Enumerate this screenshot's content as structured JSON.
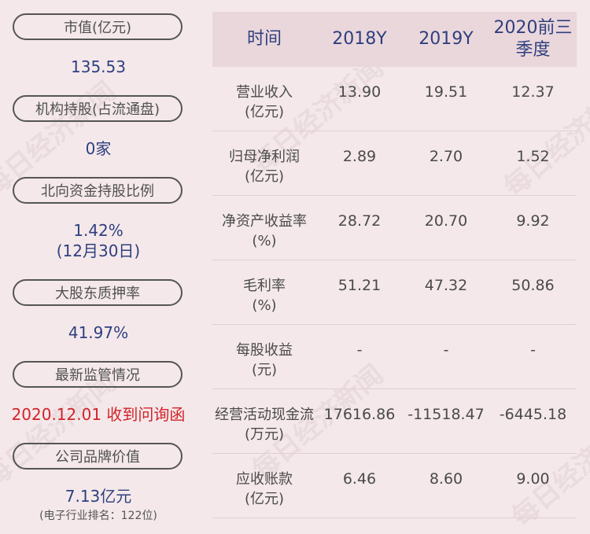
{
  "left": {
    "items": [
      {
        "label": "市值(亿元)",
        "value": "135.53"
      },
      {
        "label": "机构持股(占流通盘)",
        "value": "0家"
      },
      {
        "label": "北向资金持股比例",
        "value": "1.42%",
        "value2": "(12月30日)"
      },
      {
        "label": "大股东质押率",
        "value": "41.97%"
      },
      {
        "label": "最新监管情况",
        "value": "2020.12.01 收到问询函",
        "value_color": "#d2232a"
      },
      {
        "label": "公司品牌价值",
        "value": "7.13亿元",
        "value2": "(电子行业排名：122位)"
      }
    ]
  },
  "table": {
    "headers": [
      "时间",
      "2018Y",
      "2019Y",
      "2020前三季度"
    ],
    "header_line1": "2020前三",
    "header_line2": "季度",
    "rows": [
      {
        "label1": "营业收入",
        "label2": "(亿元)",
        "values": [
          "13.90",
          "19.51",
          "12.37"
        ]
      },
      {
        "label1": "归母净利润",
        "label2": "(亿元)",
        "values": [
          "2.89",
          "2.70",
          "1.52"
        ]
      },
      {
        "label1": "净资产收益率",
        "label2": "(%)",
        "values": [
          "28.72",
          "20.70",
          "9.92"
        ]
      },
      {
        "label1": "毛利率",
        "label2": "(%)",
        "values": [
          "51.21",
          "47.32",
          "50.86"
        ]
      },
      {
        "label1": "每股收益",
        "label2": "(元)",
        "values": [
          "-",
          "-",
          "-"
        ]
      },
      {
        "label1": "经营活动现金流",
        "label2": "(万元)",
        "values": [
          "17616.86",
          "-11518.47",
          "-6445.18"
        ]
      },
      {
        "label1": "应收账款",
        "label2": "(亿元)",
        "values": [
          "6.46",
          "8.60",
          "9.00"
        ]
      }
    ]
  },
  "watermark": "每日经济新闻"
}
